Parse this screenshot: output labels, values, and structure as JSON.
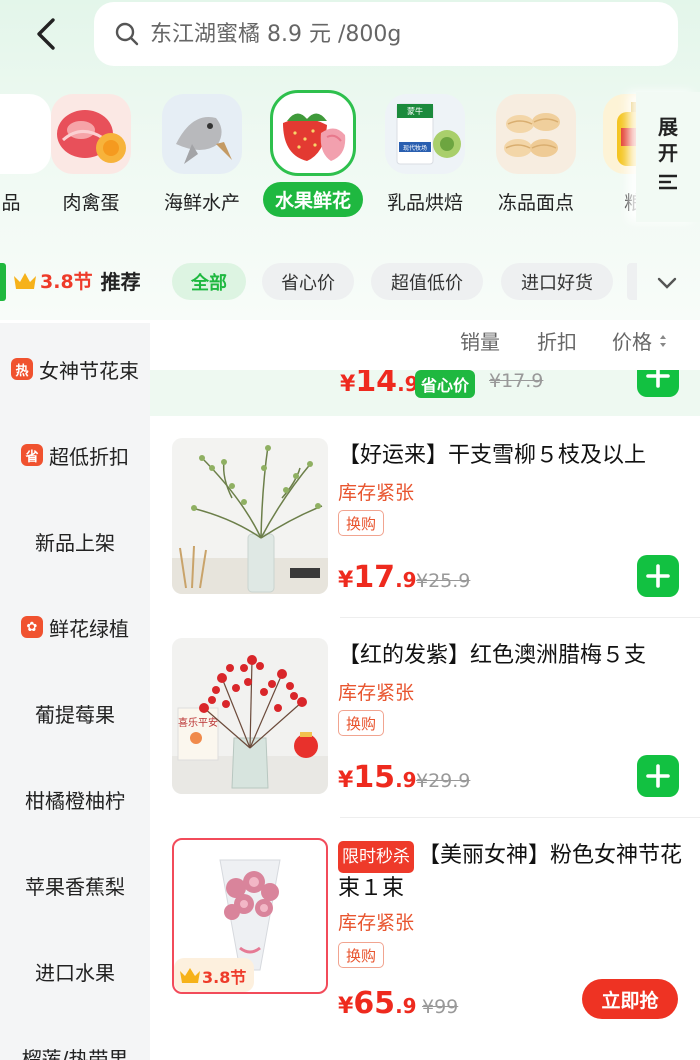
{
  "search": {
    "placeholder": "东江湖蜜橘 8.9 元 /800g"
  },
  "categories": [
    {
      "label": "品"
    },
    {
      "label": "肉禽蛋"
    },
    {
      "label": "海鲜水产"
    },
    {
      "label": "水果鲜花"
    },
    {
      "label": "乳品烘焙"
    },
    {
      "label": "冻品面点"
    },
    {
      "label": "粮油"
    }
  ],
  "category_thumb_text": {
    "dairy_brand": "蒙牛",
    "dairy_line": "现代牧场"
  },
  "expand": {
    "line1": "展",
    "line2": "开"
  },
  "recommend": {
    "fest": "3.8节",
    "label": "推荐"
  },
  "filters": [
    "全部",
    "省心价",
    "超值低价",
    "进口好货"
  ],
  "sidebar": [
    {
      "label": "女神节花束",
      "badge": "热"
    },
    {
      "label": "超低折扣",
      "badge": "省"
    },
    {
      "label": "新品上架"
    },
    {
      "label": "鲜花绿植",
      "badge": "✿"
    },
    {
      "label": "葡提莓果"
    },
    {
      "label": "柑橘橙柚柠"
    },
    {
      "label": "苹果香蕉梨"
    },
    {
      "label": "进口水果"
    },
    {
      "label": "榴莲/热带果"
    }
  ],
  "sort": {
    "sales": "销量",
    "discount": "折扣",
    "price": "价格"
  },
  "prev_item": {
    "cur": "¥",
    "int": "14",
    "dec": ".9",
    "tag": "省心价",
    "orig": "¥17.9"
  },
  "products": [
    {
      "title": "【好运来】干支雪柳５枝及以上",
      "stock": "库存紧张",
      "swap": "换购",
      "cur": "¥",
      "int": "17",
      "dec": ".9",
      "orig": "¥25.9"
    },
    {
      "title": "【红的发紫】红色澳洲腊梅５支",
      "stock": "库存紧张",
      "swap": "换购",
      "cur": "¥",
      "int": "15",
      "dec": ".9",
      "orig": "¥29.9",
      "card_text": "喜乐平安"
    },
    {
      "flash": "限时秒杀",
      "title": "【美丽女神】粉色女神节花束１束",
      "stock": "库存紧张",
      "swap": "换购",
      "cur": "¥",
      "int": "65",
      "dec": ".9",
      "orig": "¥99",
      "buy": "立即抢",
      "fest_badge": "3.8节"
    }
  ],
  "colors": {
    "green": "#1fb840",
    "red": "#ee2a1e",
    "orange": "#e8552f"
  }
}
